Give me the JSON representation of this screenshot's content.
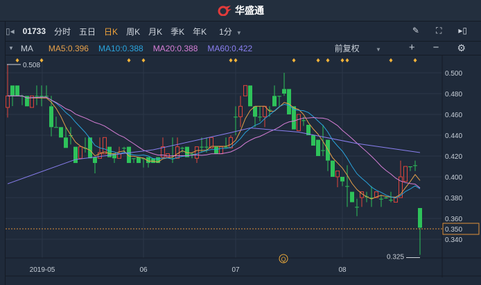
{
  "title": {
    "brand": "华盛通"
  },
  "toolbar": {
    "code": "01733",
    "periods": [
      "分时",
      "五日",
      "日K",
      "周K",
      "月K",
      "季K",
      "年K"
    ],
    "active": "日K",
    "minute": "1分",
    "minute_caret": "▼"
  },
  "indicator": {
    "name": "MA",
    "caret": "▼",
    "ma5": "MA5:0.396",
    "ma10": "MA10:0.388",
    "ma20": "MA20:0.388",
    "ma60": "MA60:0.422",
    "adjust": "前复权",
    "plus": "+",
    "minus": "−"
  },
  "colors": {
    "up": "#e0453c",
    "down": "#2ec25a",
    "ma5": "#e6a04a",
    "ma10": "#2aa3dc",
    "ma20": "#d67ed6",
    "ma60": "#8a7ff0",
    "last": "#e0913a"
  },
  "chart_data": {
    "type": "candlestick",
    "price_ticks": [
      "0.500",
      "0.480",
      "0.460",
      "0.440",
      "0.420",
      "0.400",
      "0.380",
      "0.360",
      "0.340"
    ],
    "tick_values": [
      0.5,
      0.48,
      0.46,
      0.44,
      0.42,
      0.4,
      0.38,
      0.36,
      0.34
    ],
    "ylim": [
      0.318,
      0.5133
    ],
    "date_labels": [
      {
        "label": "2019-05",
        "index": 7
      },
      {
        "label": "06",
        "index": 28
      },
      {
        "label": "07",
        "index": 47
      },
      {
        "label": "08",
        "index": 69
      }
    ],
    "high_label": "0.508",
    "low_label": "0.325",
    "last_price": "0.350",
    "last_value": 0.35,
    "marker_indices": [
      2,
      7,
      25,
      28,
      46,
      47,
      59,
      64,
      66,
      69,
      70,
      79,
      84
    ],
    "event_icon": "Q",
    "event_index": 57,
    "ohlc": [
      [
        0.4667,
        0.508,
        0.457,
        0.4778
      ],
      [
        0.4878,
        0.4878,
        0.468,
        0.4778
      ],
      [
        0.4878,
        0.4878,
        0.4778,
        0.4778
      ],
      [
        0.4778,
        0.4789,
        0.4689,
        0.4778
      ],
      [
        0.4778,
        0.4778,
        0.4678,
        0.4678
      ],
      [
        0.4667,
        0.4778,
        0.4667,
        0.4778
      ],
      [
        0.4778,
        0.4878,
        0.4689,
        0.4778
      ],
      [
        0.4778,
        0.4878,
        0.4678,
        0.4778
      ],
      [
        0.4778,
        0.4878,
        0.4778,
        0.4778
      ],
      [
        0.4678,
        0.4778,
        0.4389,
        0.4478
      ],
      [
        0.4478,
        0.4578,
        0.4478,
        0.4478
      ],
      [
        0.4478,
        0.4478,
        0.4378,
        0.4378
      ],
      [
        0.4378,
        0.4478,
        0.4278,
        0.4278
      ],
      [
        0.44,
        0.4478,
        0.4311,
        0.44
      ],
      [
        0.4289,
        0.4289,
        0.4133,
        0.4133
      ],
      [
        0.4178,
        0.4289,
        0.4178,
        0.4289
      ],
      [
        0.4278,
        0.4378,
        0.4233,
        0.4278
      ],
      [
        0.4378,
        0.4378,
        0.4178,
        0.4178
      ],
      [
        0.4189,
        0.4189,
        0.4033,
        0.4133
      ],
      [
        0.4178,
        0.4378,
        0.4178,
        0.4233
      ],
      [
        0.4222,
        0.4378,
        0.4222,
        0.4378
      ],
      [
        0.4289,
        0.4289,
        0.4189,
        0.4189
      ],
      [
        0.4222,
        0.4222,
        0.4133,
        0.4178
      ],
      [
        0.4178,
        0.4289,
        0.4178,
        0.4222
      ],
      [
        0.4278,
        0.4289,
        0.4233,
        0.4278
      ],
      [
        0.4289,
        0.4289,
        0.4133,
        0.4133
      ],
      [
        0.4178,
        0.4178,
        0.4133,
        0.4178
      ],
      [
        0.4189,
        0.4189,
        0.4133,
        0.4133
      ],
      [
        0.4178,
        0.4178,
        0.4089,
        0.4178
      ],
      [
        0.4189,
        0.4189,
        0.4089,
        0.4133
      ],
      [
        0.4178,
        0.4178,
        0.4133,
        0.4133
      ],
      [
        0.4189,
        0.4189,
        0.4133,
        0.4133
      ],
      [
        0.4189,
        0.4378,
        0.4189,
        0.4289
      ],
      [
        0.4189,
        0.4222,
        0.4189,
        0.4222
      ],
      [
        0.4178,
        0.4378,
        0.4133,
        0.4178
      ],
      [
        0.4178,
        0.4378,
        0.4178,
        0.4289
      ],
      [
        0.4278,
        0.4289,
        0.4233,
        0.4278
      ],
      [
        0.4289,
        0.4289,
        0.4189,
        0.4189
      ],
      [
        0.4222,
        0.4233,
        0.4178,
        0.4222
      ],
      [
        0.4178,
        0.4289,
        0.4133,
        0.4289
      ],
      [
        0.4289,
        0.4378,
        0.4233,
        0.4289
      ],
      [
        0.4289,
        0.4378,
        0.4233,
        0.4289
      ],
      [
        0.4278,
        0.4378,
        0.4278,
        0.4378
      ],
      [
        0.4289,
        0.4289,
        0.4222,
        0.4222
      ],
      [
        0.4222,
        0.4289,
        0.4222,
        0.4289
      ],
      [
        0.4289,
        0.4378,
        0.4278,
        0.4289
      ],
      [
        0.4278,
        0.44,
        0.4278,
        0.4378
      ],
      [
        0.4578,
        0.4678,
        0.44,
        0.4578
      ],
      [
        0.4578,
        0.4778,
        0.4478,
        0.4678
      ],
      [
        0.4778,
        0.4878,
        0.4778,
        0.4878
      ],
      [
        0.4878,
        0.4878,
        0.4678,
        0.4678
      ],
      [
        0.4678,
        0.4678,
        0.4478,
        0.4578
      ],
      [
        0.4578,
        0.4678,
        0.4533,
        0.4578
      ],
      [
        0.4578,
        0.4678,
        0.4478,
        0.4678
      ],
      [
        0.4644,
        0.4678,
        0.4578,
        0.4644
      ],
      [
        0.4778,
        0.4878,
        0.4678,
        0.4678
      ],
      [
        0.4778,
        0.4778,
        0.4678,
        0.4778
      ],
      [
        0.4844,
        0.5,
        0.4778,
        0.48
      ],
      [
        0.4844,
        0.4844,
        0.46,
        0.46
      ],
      [
        0.4678,
        0.4678,
        0.4456,
        0.4456
      ],
      [
        0.4444,
        0.46,
        0.4444,
        0.46
      ],
      [
        0.4544,
        0.4578,
        0.4489,
        0.4544
      ],
      [
        0.45,
        0.45,
        0.44,
        0.44
      ],
      [
        0.44,
        0.44,
        0.43,
        0.43
      ],
      [
        0.4356,
        0.4356,
        0.42,
        0.42
      ],
      [
        0.4256,
        0.45,
        0.42,
        0.4256
      ],
      [
        0.4356,
        0.4356,
        0.4056,
        0.4156
      ],
      [
        0.4156,
        0.4156,
        0.4,
        0.4
      ],
      [
        0.4,
        0.4056,
        0.39,
        0.4056
      ],
      [
        0.4,
        0.4,
        0.3911,
        0.3956
      ],
      [
        0.3911,
        0.4111,
        0.3711,
        0.3911
      ],
      [
        0.3856,
        0.3856,
        0.3756,
        0.3756
      ],
      [
        0.3711,
        0.3789,
        0.3622,
        0.3711
      ],
      [
        0.38,
        0.3856,
        0.3711,
        0.3856
      ],
      [
        0.3811,
        0.3856,
        0.3756,
        0.3811
      ],
      [
        0.38,
        0.3911,
        0.3711,
        0.38
      ],
      [
        0.38,
        0.3856,
        0.38,
        0.3856
      ],
      [
        0.3789,
        0.3822,
        0.3711,
        0.3789
      ],
      [
        0.38,
        0.3811,
        0.3789,
        0.38
      ],
      [
        0.3778,
        0.3856,
        0.3756,
        0.3778
      ],
      [
        0.3756,
        0.38,
        0.3756,
        0.38
      ],
      [
        0.38,
        0.4156,
        0.38,
        0.4
      ],
      [
        0.3956,
        0.41,
        0.3956,
        0.41
      ],
      [
        0.41,
        0.41,
        0.4056,
        0.41
      ],
      [
        0.4111,
        0.4156,
        0.4056,
        0.4111
      ],
      [
        0.37,
        0.37,
        0.325,
        0.3511
      ]
    ],
    "ma60_samples": [
      [
        0,
        0.3933
      ],
      [
        14,
        0.4167
      ],
      [
        30,
        0.426
      ],
      [
        46,
        0.4425
      ],
      [
        50,
        0.447
      ],
      [
        60,
        0.443
      ],
      [
        72,
        0.432
      ],
      [
        85,
        0.4233
      ]
    ]
  }
}
